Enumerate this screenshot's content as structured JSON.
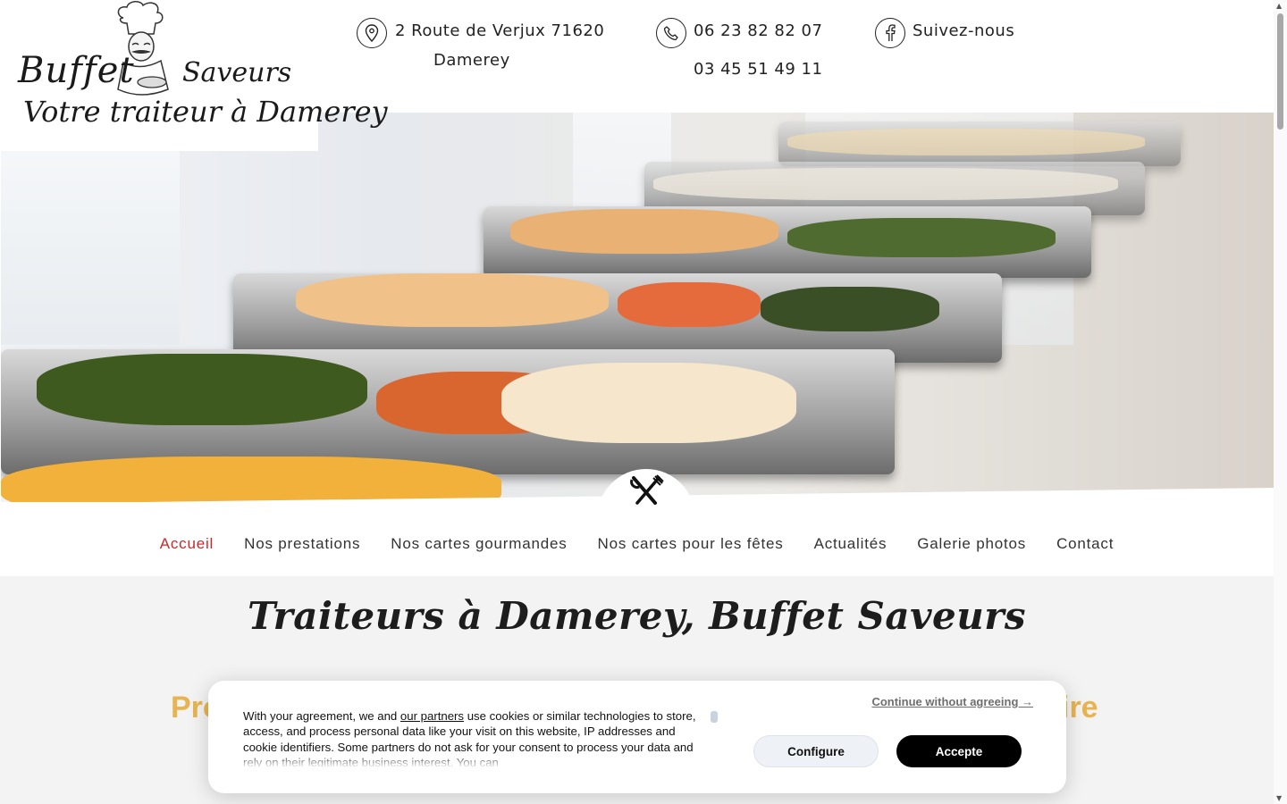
{
  "logo": {
    "line1a": "Buffet",
    "line1b": "Saveurs",
    "line2": "Votre traiteur à Damerey"
  },
  "header": {
    "address_line1": "2 Route de Verjux 71620",
    "address_line2": "Damerey",
    "phone1": "06 23 82 82 07",
    "phone2": "03 45 51 49 11",
    "social": "Suivez-nous"
  },
  "nav": {
    "items": [
      "Accueil",
      "Nos prestations",
      "Nos cartes gourmandes",
      "Nos cartes pour les fêtes",
      "Actualités",
      "Galerie photos",
      "Contact"
    ],
    "active": "Accueil"
  },
  "content": {
    "title": "Traiteurs à Damerey, Buffet Saveurs",
    "heading_left": "Pro",
    "heading_right": "ire"
  },
  "cookie": {
    "text_before": "With your agreement, we and ",
    "partners_link": "our partners",
    "text_after": " use cookies or similar technologies to store, access, and process personal data like your visit on this website, IP addresses and cookie identifiers. Some partners do not ask for your consent to process your data and rely on their legitimate business interest. You can",
    "continue_without": "Continue without agreeing →",
    "configure": "Configure",
    "accept": "Accepte"
  },
  "colors": {
    "accent_red": "#c9282d",
    "heading_orange": "#e8b451",
    "content_bg": "#f3f3f3"
  },
  "icons": [
    "location-pin-icon",
    "phone-icon",
    "facebook-icon",
    "fork-knife-icon"
  ]
}
